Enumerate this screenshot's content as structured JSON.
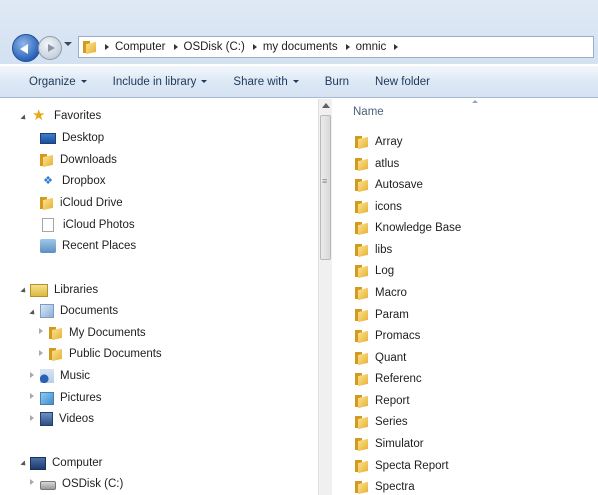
{
  "address": {
    "crumbs": [
      "Computer",
      "OSDisk (C:)",
      "my documents",
      "omnic"
    ]
  },
  "toolbar": {
    "organize": "Organize",
    "include_in_library": "Include in library",
    "share_with": "Share with",
    "burn": "Burn",
    "new_folder": "New folder"
  },
  "nav": {
    "favorites": "Favorites",
    "desktop": "Desktop",
    "downloads": "Downloads",
    "dropbox": "Dropbox",
    "icloud_drive": "iCloud Drive",
    "icloud_photos": "iCloud Photos",
    "recent_places": "Recent Places",
    "libraries": "Libraries",
    "documents": "Documents",
    "my_documents": "My Documents",
    "public_documents": "Public Documents",
    "music": "Music",
    "pictures": "Pictures",
    "videos": "Videos",
    "computer": "Computer",
    "osdisk": "OSDisk (C:)"
  },
  "content": {
    "column_name": "Name",
    "files": [
      "Array",
      "atlus",
      "Autosave",
      "icons",
      "Knowledge Base",
      "libs",
      "Log",
      "Macro",
      "Param",
      "Promacs",
      "Quant",
      "Referenc",
      "Report",
      "Series",
      "Simulator",
      "Specta Report",
      "Spectra"
    ]
  },
  "colors": {
    "accent": "#1e395b",
    "folder": "#e8b43a"
  }
}
